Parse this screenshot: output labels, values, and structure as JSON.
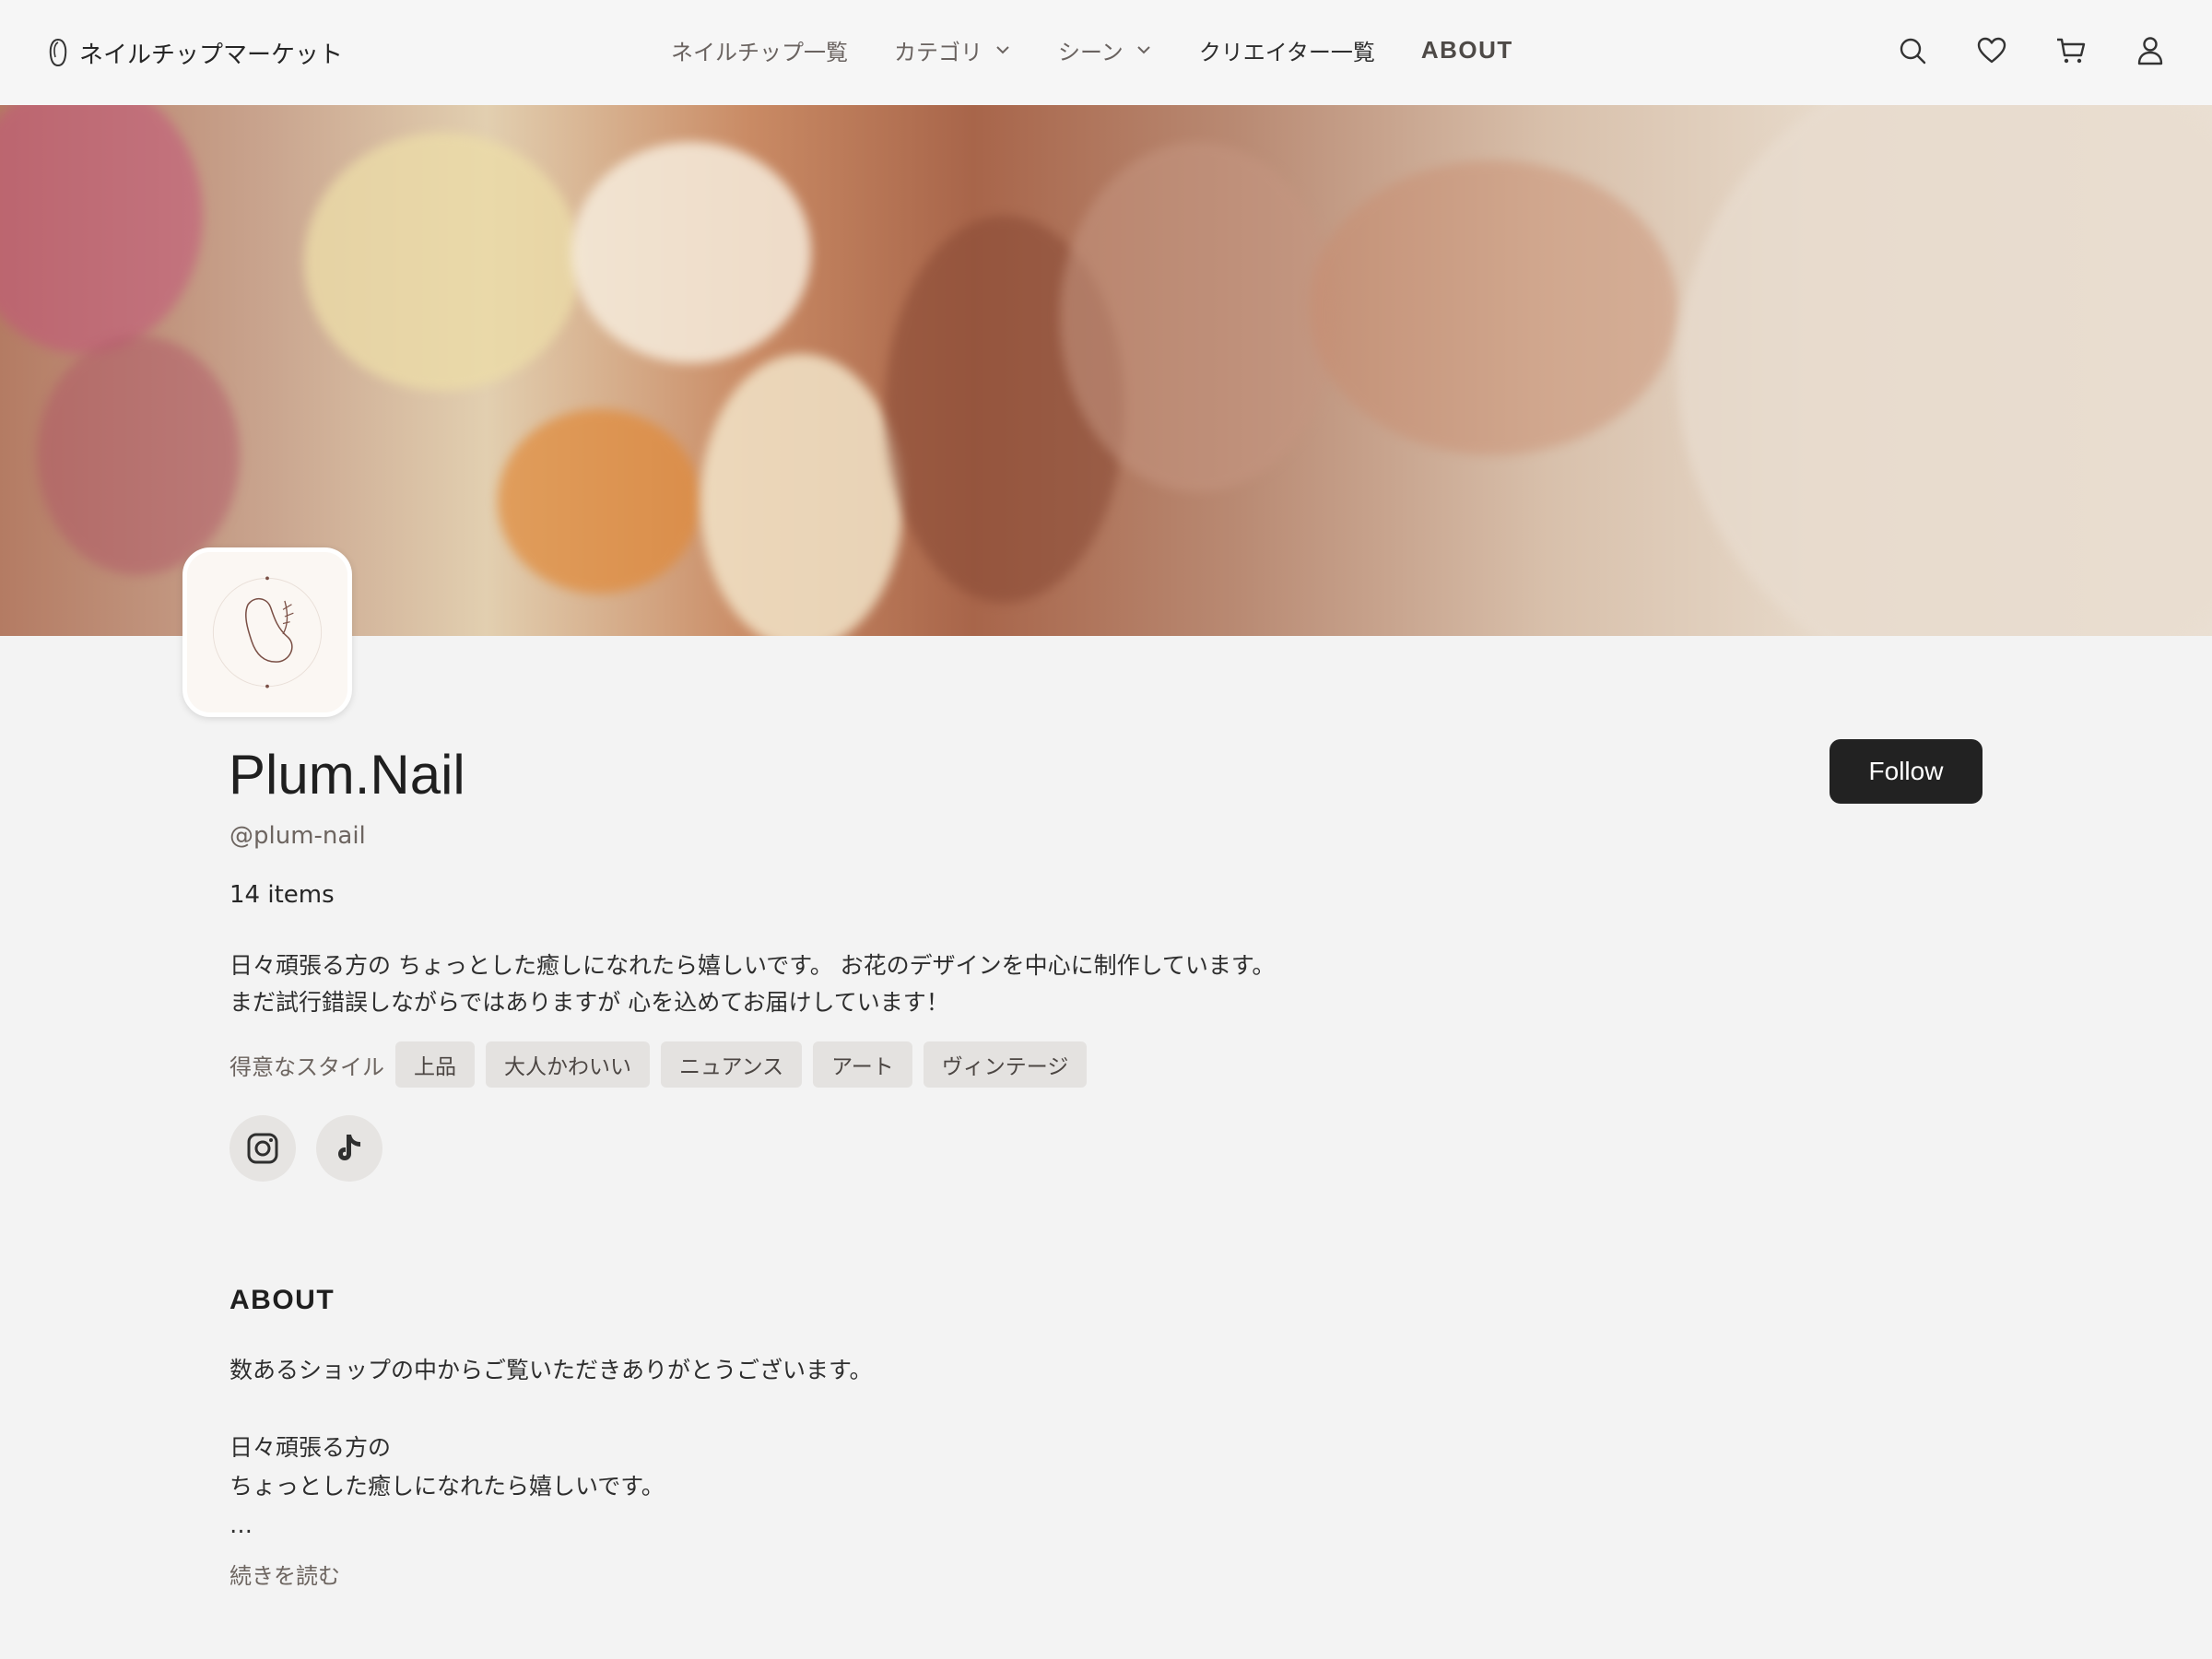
{
  "header": {
    "brand": "ネイルチップマーケット",
    "nav": [
      {
        "label": "ネイルチップ一覧"
      },
      {
        "label": "カテゴリ"
      },
      {
        "label": "シーン"
      },
      {
        "label": "クリエイター一覧"
      },
      {
        "label": "ABOUT"
      }
    ],
    "icons": [
      "search-icon",
      "heart-icon",
      "cart-icon",
      "user-icon"
    ]
  },
  "profile": {
    "name": "Plum.Nail",
    "handle": "@plum-nail",
    "items": "14 items",
    "bio": [
      "日々頑張る方の ちょっとした癒しになれたら嬉しいです。 お花のデザインを中心に制作しています。",
      "まだ試行錯誤しながらではありますが 心を込めてお届けしています！"
    ],
    "styles_label": "得意なスタイル",
    "styles": [
      "上品",
      "大人かわいい",
      "ニュアンス",
      "アート",
      "ヴィンテージ"
    ],
    "social": [
      "instagram-icon",
      "tiktok-icon"
    ],
    "follow_label": "Follow"
  },
  "about": {
    "title": "ABOUT",
    "lines": [
      "数あるショップの中からご覧いただきありがとうございます。",
      "",
      "日々頑張る方の",
      "ちょっとした癒しになれたら嬉しいです。",
      "…"
    ],
    "read_more": "続きを読む"
  },
  "colors": {
    "background": "#f3f3f3",
    "follow_bg": "#222222",
    "chip_bg": "#e4e2e0"
  }
}
